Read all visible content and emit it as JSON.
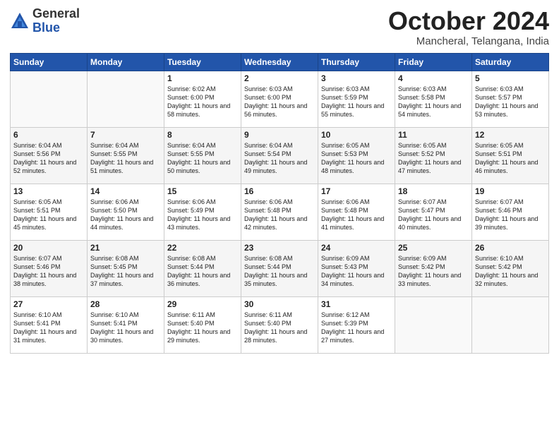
{
  "logo": {
    "general": "General",
    "blue": "Blue"
  },
  "title": {
    "month": "October 2024",
    "location": "Mancheral, Telangana, India"
  },
  "headers": [
    "Sunday",
    "Monday",
    "Tuesday",
    "Wednesday",
    "Thursday",
    "Friday",
    "Saturday"
  ],
  "weeks": [
    [
      {
        "day": "",
        "info": ""
      },
      {
        "day": "",
        "info": ""
      },
      {
        "day": "1",
        "info": "Sunrise: 6:02 AM\nSunset: 6:00 PM\nDaylight: 11 hours and 58 minutes."
      },
      {
        "day": "2",
        "info": "Sunrise: 6:03 AM\nSunset: 6:00 PM\nDaylight: 11 hours and 56 minutes."
      },
      {
        "day": "3",
        "info": "Sunrise: 6:03 AM\nSunset: 5:59 PM\nDaylight: 11 hours and 55 minutes."
      },
      {
        "day": "4",
        "info": "Sunrise: 6:03 AM\nSunset: 5:58 PM\nDaylight: 11 hours and 54 minutes."
      },
      {
        "day": "5",
        "info": "Sunrise: 6:03 AM\nSunset: 5:57 PM\nDaylight: 11 hours and 53 minutes."
      }
    ],
    [
      {
        "day": "6",
        "info": "Sunrise: 6:04 AM\nSunset: 5:56 PM\nDaylight: 11 hours and 52 minutes."
      },
      {
        "day": "7",
        "info": "Sunrise: 6:04 AM\nSunset: 5:55 PM\nDaylight: 11 hours and 51 minutes."
      },
      {
        "day": "8",
        "info": "Sunrise: 6:04 AM\nSunset: 5:55 PM\nDaylight: 11 hours and 50 minutes."
      },
      {
        "day": "9",
        "info": "Sunrise: 6:04 AM\nSunset: 5:54 PM\nDaylight: 11 hours and 49 minutes."
      },
      {
        "day": "10",
        "info": "Sunrise: 6:05 AM\nSunset: 5:53 PM\nDaylight: 11 hours and 48 minutes."
      },
      {
        "day": "11",
        "info": "Sunrise: 6:05 AM\nSunset: 5:52 PM\nDaylight: 11 hours and 47 minutes."
      },
      {
        "day": "12",
        "info": "Sunrise: 6:05 AM\nSunset: 5:51 PM\nDaylight: 11 hours and 46 minutes."
      }
    ],
    [
      {
        "day": "13",
        "info": "Sunrise: 6:05 AM\nSunset: 5:51 PM\nDaylight: 11 hours and 45 minutes."
      },
      {
        "day": "14",
        "info": "Sunrise: 6:06 AM\nSunset: 5:50 PM\nDaylight: 11 hours and 44 minutes."
      },
      {
        "day": "15",
        "info": "Sunrise: 6:06 AM\nSunset: 5:49 PM\nDaylight: 11 hours and 43 minutes."
      },
      {
        "day": "16",
        "info": "Sunrise: 6:06 AM\nSunset: 5:48 PM\nDaylight: 11 hours and 42 minutes."
      },
      {
        "day": "17",
        "info": "Sunrise: 6:06 AM\nSunset: 5:48 PM\nDaylight: 11 hours and 41 minutes."
      },
      {
        "day": "18",
        "info": "Sunrise: 6:07 AM\nSunset: 5:47 PM\nDaylight: 11 hours and 40 minutes."
      },
      {
        "day": "19",
        "info": "Sunrise: 6:07 AM\nSunset: 5:46 PM\nDaylight: 11 hours and 39 minutes."
      }
    ],
    [
      {
        "day": "20",
        "info": "Sunrise: 6:07 AM\nSunset: 5:46 PM\nDaylight: 11 hours and 38 minutes."
      },
      {
        "day": "21",
        "info": "Sunrise: 6:08 AM\nSunset: 5:45 PM\nDaylight: 11 hours and 37 minutes."
      },
      {
        "day": "22",
        "info": "Sunrise: 6:08 AM\nSunset: 5:44 PM\nDaylight: 11 hours and 36 minutes."
      },
      {
        "day": "23",
        "info": "Sunrise: 6:08 AM\nSunset: 5:44 PM\nDaylight: 11 hours and 35 minutes."
      },
      {
        "day": "24",
        "info": "Sunrise: 6:09 AM\nSunset: 5:43 PM\nDaylight: 11 hours and 34 minutes."
      },
      {
        "day": "25",
        "info": "Sunrise: 6:09 AM\nSunset: 5:42 PM\nDaylight: 11 hours and 33 minutes."
      },
      {
        "day": "26",
        "info": "Sunrise: 6:10 AM\nSunset: 5:42 PM\nDaylight: 11 hours and 32 minutes."
      }
    ],
    [
      {
        "day": "27",
        "info": "Sunrise: 6:10 AM\nSunset: 5:41 PM\nDaylight: 11 hours and 31 minutes."
      },
      {
        "day": "28",
        "info": "Sunrise: 6:10 AM\nSunset: 5:41 PM\nDaylight: 11 hours and 30 minutes."
      },
      {
        "day": "29",
        "info": "Sunrise: 6:11 AM\nSunset: 5:40 PM\nDaylight: 11 hours and 29 minutes."
      },
      {
        "day": "30",
        "info": "Sunrise: 6:11 AM\nSunset: 5:40 PM\nDaylight: 11 hours and 28 minutes."
      },
      {
        "day": "31",
        "info": "Sunrise: 6:12 AM\nSunset: 5:39 PM\nDaylight: 11 hours and 27 minutes."
      },
      {
        "day": "",
        "info": ""
      },
      {
        "day": "",
        "info": ""
      }
    ]
  ]
}
